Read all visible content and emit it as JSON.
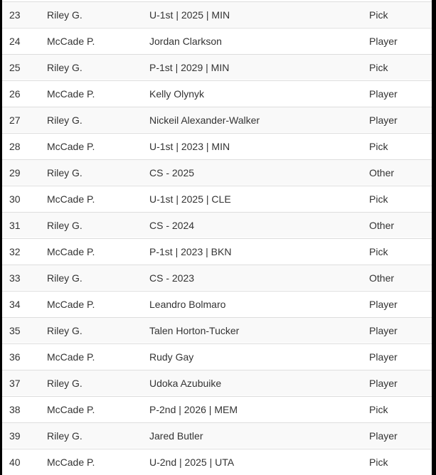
{
  "rows": [
    {
      "pick": "23",
      "team": "Riley G.",
      "asset": "U-1st | 2025 | MIN",
      "type": "Pick"
    },
    {
      "pick": "24",
      "team": "McCade P.",
      "asset": "Jordan Clarkson",
      "type": "Player"
    },
    {
      "pick": "25",
      "team": "Riley G.",
      "asset": "P-1st | 2029 | MIN",
      "type": "Pick"
    },
    {
      "pick": "26",
      "team": "McCade P.",
      "asset": "Kelly Olynyk",
      "type": "Player"
    },
    {
      "pick": "27",
      "team": "Riley G.",
      "asset": "Nickeil Alexander-Walker",
      "type": "Player"
    },
    {
      "pick": "28",
      "team": "McCade P.",
      "asset": "U-1st | 2023 | MIN",
      "type": "Pick"
    },
    {
      "pick": "29",
      "team": "Riley G.",
      "asset": "CS - 2025",
      "type": "Other"
    },
    {
      "pick": "30",
      "team": "McCade P.",
      "asset": "U-1st | 2025 | CLE",
      "type": "Pick"
    },
    {
      "pick": "31",
      "team": "Riley G.",
      "asset": "CS - 2024",
      "type": "Other"
    },
    {
      "pick": "32",
      "team": "McCade P.",
      "asset": "P-1st | 2023 | BKN",
      "type": "Pick"
    },
    {
      "pick": "33",
      "team": "Riley G.",
      "asset": "CS - 2023",
      "type": "Other"
    },
    {
      "pick": "34",
      "team": "McCade P.",
      "asset": "Leandro Bolmaro",
      "type": "Player"
    },
    {
      "pick": "35",
      "team": "Riley G.",
      "asset": "Talen Horton-Tucker",
      "type": "Player"
    },
    {
      "pick": "36",
      "team": "McCade P.",
      "asset": "Rudy Gay",
      "type": "Player"
    },
    {
      "pick": "37",
      "team": "Riley G.",
      "asset": "Udoka Azubuike",
      "type": "Player"
    },
    {
      "pick": "38",
      "team": "McCade P.",
      "asset": "P-2nd | 2026 | MEM",
      "type": "Pick"
    },
    {
      "pick": "39",
      "team": "Riley G.",
      "asset": "Jared Butler",
      "type": "Player"
    },
    {
      "pick": "40",
      "team": "McCade P.",
      "asset": "U-2nd | 2025 | UTA",
      "type": "Pick"
    }
  ]
}
